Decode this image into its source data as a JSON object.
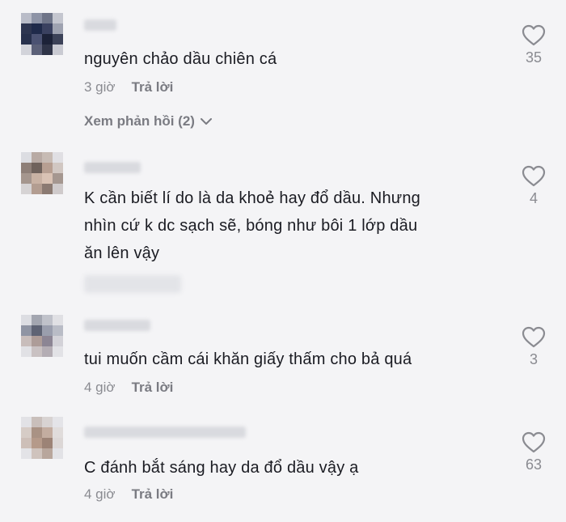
{
  "comments": [
    {
      "text_lines": [
        "nguyên chảo dầu chiên cá"
      ],
      "time": "3 giờ",
      "reply_label": "Trả lời",
      "view_replies": "Xem phản hồi (2)",
      "likes": "35"
    },
    {
      "text_lines": [
        "K cần biết lí do là da khoẻ hay đổ dầu. Nhưng",
        "nhìn cứ k dc sạch sẽ, bóng như bôi 1 lớp dầu",
        "ăn lên vậy"
      ],
      "likes": "4"
    },
    {
      "text_lines": [
        "tui muốn cầm cái khăn giấy thấm cho bả quá"
      ],
      "time": "4 giờ",
      "reply_label": "Trả lời",
      "likes": "3"
    },
    {
      "text_lines": [
        "C đánh bắt sáng hay da đổ dầu vậy ạ"
      ],
      "time": "4 giờ",
      "reply_label": "Trả lời",
      "likes": "63"
    }
  ],
  "icons": {
    "like": "heart-outline-icon",
    "expand": "chevron-down-icon"
  },
  "colors": {
    "background": "#f4f4f6",
    "text": "#1a1b22",
    "muted": "#8a8b91"
  }
}
